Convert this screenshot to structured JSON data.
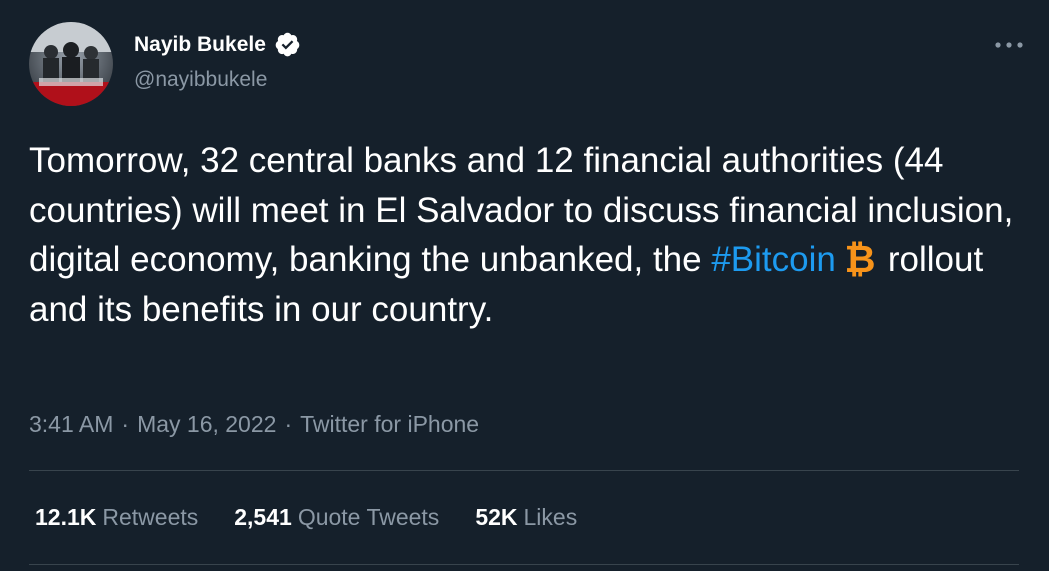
{
  "author": {
    "name": "Nayib Bukele",
    "handle": "@nayibbukele",
    "verified": true,
    "avatar_icon": "profile-photo"
  },
  "menu": {
    "icon": "more-horizontal-icon"
  },
  "tweet": {
    "text_before_hashtag": "Tomorrow, 32 central banks and 12 financial authorities (44 countries) will meet in El Salvador to discuss financial inclusion, digital economy, banking the unbanked, the ",
    "hashtag": "#Bitcoin",
    "hashtag_icon": "bitcoin-icon",
    "text_after_hashtag": "rollout and its benefits in our country."
  },
  "meta": {
    "time": "3:41 AM",
    "separator": "·",
    "date": "May 16, 2022",
    "source": "Twitter for iPhone"
  },
  "stats": {
    "retweets": {
      "value": "12.1K",
      "label": "Retweets"
    },
    "quote_tweets": {
      "value": "2,541",
      "label": "Quote Tweets"
    },
    "likes": {
      "value": "52K",
      "label": "Likes"
    }
  },
  "colors": {
    "background": "#15202b",
    "accent": "#1d9bf0",
    "secondary_text": "#8b98a5",
    "divider": "#38444d",
    "bitcoin": "#f7931a"
  }
}
